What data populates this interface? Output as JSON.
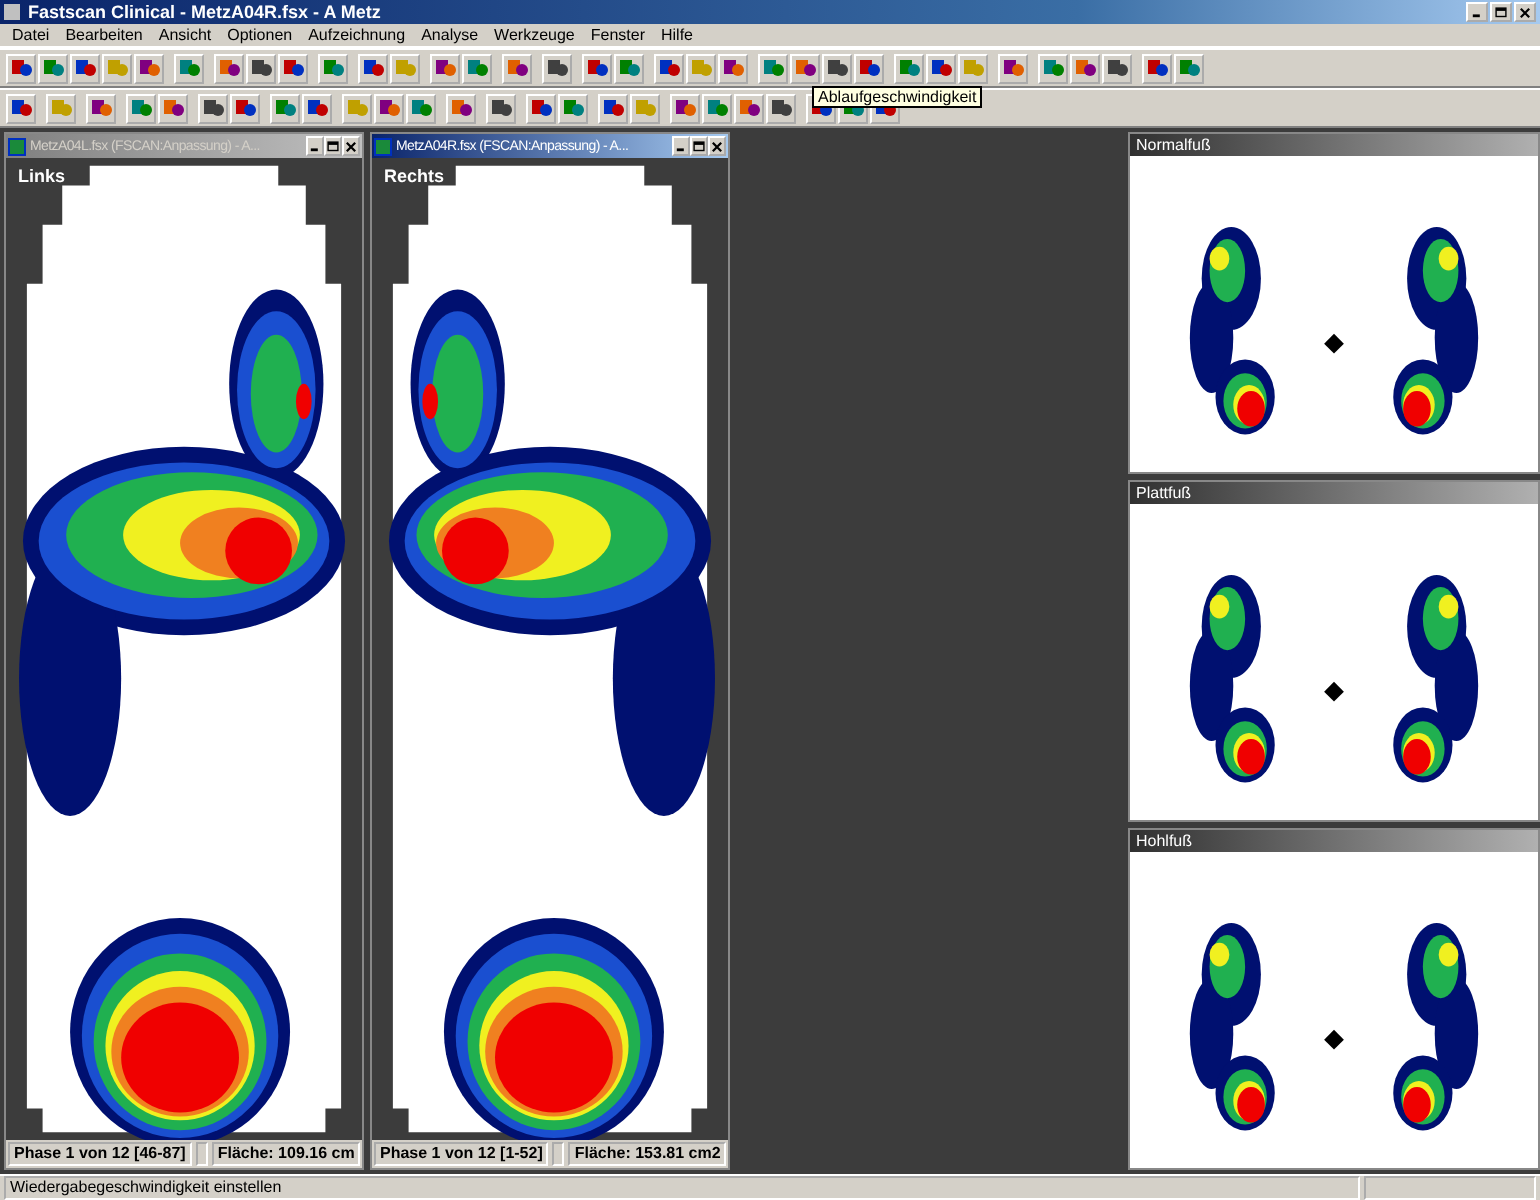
{
  "window": {
    "title": "Fastscan Clinical - MetzA04R.fsx - A  Metz"
  },
  "menu": [
    "Datei",
    "Bearbeiten",
    "Ansicht",
    "Optionen",
    "Aufzeichnung",
    "Analyse",
    "Werkzeuge",
    "Fenster",
    "Hilfe"
  ],
  "tooltip": "Ablaufgeschwindigkeit",
  "documents": [
    {
      "title": "MetzA04L.fsx (FSCAN:Anpassung) - A...",
      "active": false,
      "label": "Links",
      "phase": "Phase 1 von 12 [46-87]",
      "area": "Fläche: 109.16 cm"
    },
    {
      "title": "MetzA04R.fsx (FSCAN:Anpassung) - A...",
      "active": true,
      "label": "Rechts",
      "phase": "Phase 1 von 12 [1-52]",
      "area": "Fläche: 153.81 cm2"
    }
  ],
  "reference_panels": [
    {
      "title": "Normalfuß"
    },
    {
      "title": "Plattfuß"
    },
    {
      "title": "Hohlfuß"
    }
  ],
  "status_bar": {
    "text": "Wiedergabegeschwindigkeit einstellen"
  }
}
